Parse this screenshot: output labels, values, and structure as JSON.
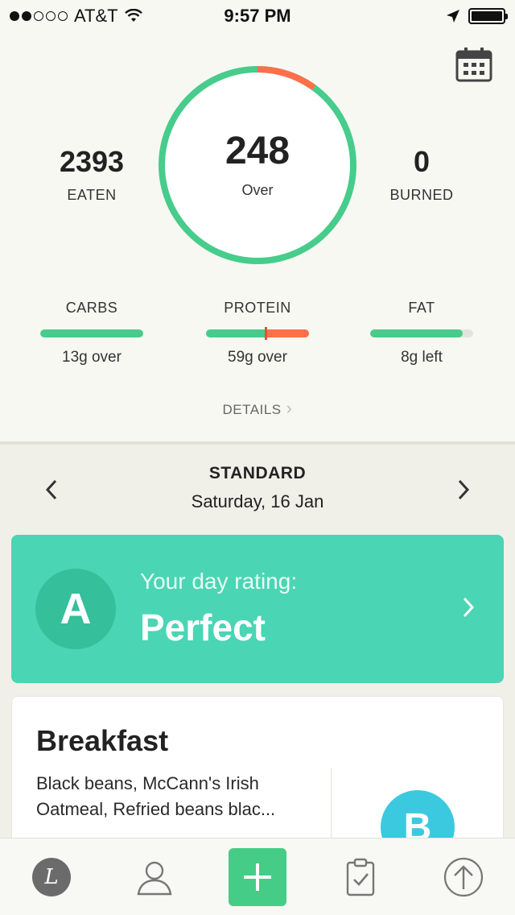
{
  "status_bar": {
    "carrier": "AT&T",
    "time": "9:57 PM"
  },
  "summary": {
    "eaten_value": "2393",
    "eaten_label": "EATEN",
    "center_value": "248",
    "center_label": "Over",
    "burned_value": "0",
    "burned_label": "BURNED",
    "ring_over_fraction": 0.1
  },
  "macros": [
    {
      "title": "CARBS",
      "status": "13g over",
      "progress": 1.0
    },
    {
      "title": "PROTEIN",
      "status": "59g over",
      "progress": 1.0
    },
    {
      "title": "FAT",
      "status": "8g left",
      "progress": 0.9
    }
  ],
  "details_label": "DETAILS",
  "date_nav": {
    "diet": "STANDARD",
    "date": "Saturday, 16 Jan"
  },
  "rating": {
    "grade": "A",
    "label": "Your day rating:",
    "value": "Perfect"
  },
  "meal": {
    "title": "Breakfast",
    "desc_line1": "Black beans, McCann's Irish",
    "desc_line2": "Oatmeal, Refried beans blac...",
    "grade": "B"
  },
  "colors": {
    "green": "#47cc8b",
    "over_red": "#ff6f4a",
    "teal": "#4ad5b4",
    "meal_grade": "#3bc9e0"
  },
  "tabs": [
    "lifesum-logo-icon",
    "profile-icon",
    "add-icon",
    "clipboard-icon",
    "upload-icon"
  ]
}
